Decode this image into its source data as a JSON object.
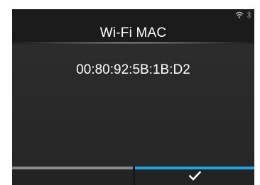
{
  "header": {
    "title": "Wi-Fi MAC",
    "status_icons": [
      "wifi-icon",
      "bluetooth-icon"
    ]
  },
  "content": {
    "mac_address": "00:80:92:5B:1B:D2"
  },
  "softkeys": {
    "left": {
      "icon": "none"
    },
    "right": {
      "icon": "checkmark-icon"
    }
  },
  "colors": {
    "accent": "#21a3e6",
    "inactive_indicator": "#8a8a8a",
    "background": "#2a2a2a",
    "text": "#ffffff"
  }
}
